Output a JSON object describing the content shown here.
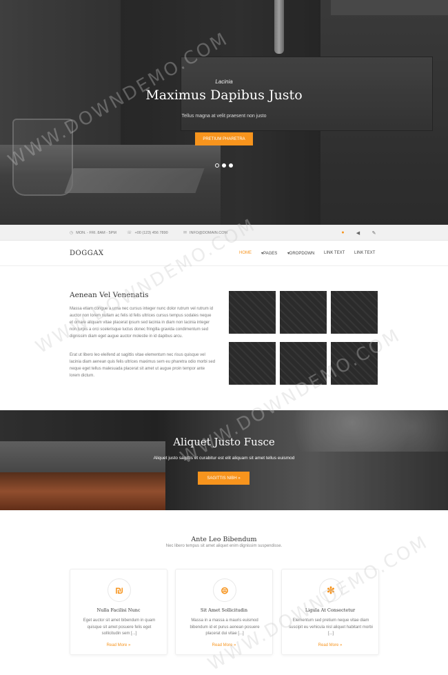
{
  "hero": {
    "eyebrow": "Lacinia",
    "title": "Maximus Dapibus Justo",
    "subtitle": "Tellus magna at velit praesent non justo",
    "button_label": "PRETIUM PHARETRA"
  },
  "topbar": {
    "hours": "MON. - FRI. 8AM - 5PM",
    "phone": "+00 (123) 456 7890",
    "email": "INFO@DOMAIN.COM"
  },
  "nav": {
    "logo": "DOGGAX",
    "items": [
      {
        "label": "HOME",
        "active": true
      },
      {
        "label": "▾PAGES",
        "active": false
      },
      {
        "label": "▾DROPDOWN",
        "active": false
      },
      {
        "label": "LINK TEXT",
        "active": false
      },
      {
        "label": "LINK TEXT",
        "active": false
      }
    ]
  },
  "about": {
    "title": "Aenean Vel Venenatis",
    "paragraph1": "Massa etiam congue a urna nec cursus integer nunc dolor rutrum vel rutrum id auctor non lorem nullam ac felis id felis ultrices cursus tempus sodales neque et ornare aliquam vitae placerat ipsum sed lacinia in diam non lacinia integer non turpis a orci scelerisque luctus donec fringilla gravida condimentum sed dignissim diam eget augue auctor molestie in id dapibus arcu.",
    "paragraph2": "Erat ut libero leo eleifend at sagittis vitae elementum nec risus quisque vel lacinia diam aenean quis felis ultrices maximus sem eu pharetra odio morbi sed neque eget tellus malesuada placerat sit amet ut augue proin tempor ante lorem dictum."
  },
  "cta": {
    "title": "Aliquet Justo Fusce",
    "subtitle": "Aliquet justo sagittis et curabitur est elit aliquam sit amet tellus euismod",
    "button_label": "SAGITTIS NIBH »"
  },
  "services": {
    "title": "Ante Leo Bibendum",
    "subtitle": "Nec libero tempus sit amet aliquet enim dignissim suspendisse.",
    "cards": [
      {
        "icon": "₪",
        "icon_name": "sheqel-icon",
        "title": "Nulla Facilisi Nunc",
        "text": "Eget auctor sit amet bibendum in quam quisque sit amet posuere felis eget sollicitudin sem [...]",
        "link": "Read More »"
      },
      {
        "icon": "⊜",
        "icon_name": "bitbucket-icon",
        "title": "Sit Amet Sollicitudin",
        "text": "Massa in a massa a mauris euismod bibendum id et purus aenean posuere placerat dui vitae [...]",
        "link": "Read More »"
      },
      {
        "icon": "✻",
        "icon_name": "yelp-icon",
        "title": "Ligula At Consectetur",
        "text": "Elementum sed pretium neque vitae diam suscipit eu vehicula nisl aliquet habitant morbi [...]",
        "link": "Read More »"
      }
    ]
  },
  "watermark": "WWW.DOWNDEMO.COM",
  "colors": {
    "accent": "#f7941d"
  }
}
